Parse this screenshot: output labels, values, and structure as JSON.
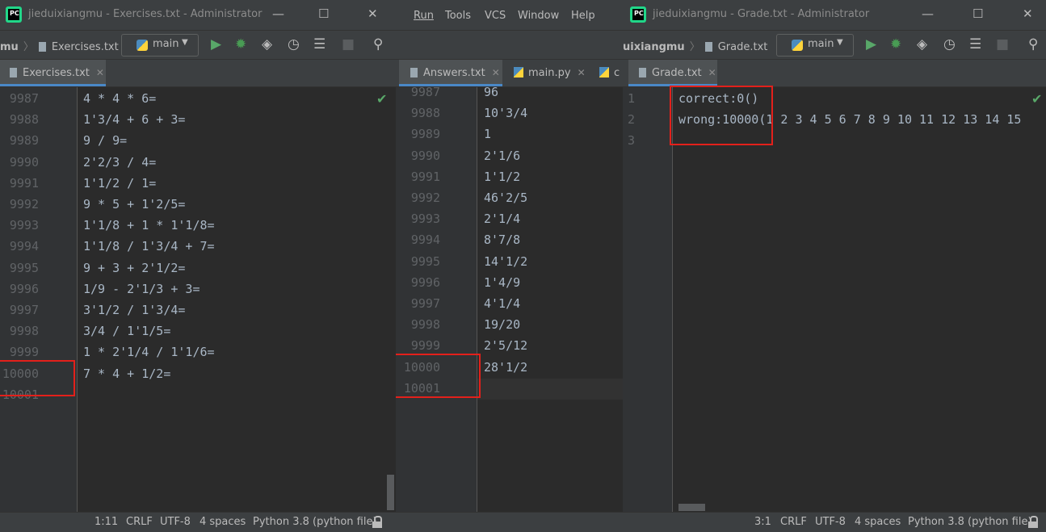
{
  "w1": {
    "title": "jieduixiangmu - Exercises.txt - Administrator",
    "logo": "PC",
    "crumb_project": "mu",
    "crumb_file": "Exercises.txt",
    "run_config": "main",
    "tab": "Exercises.txt",
    "lines": [
      "9987",
      "9988",
      "9989",
      "9990",
      "9991",
      "9992",
      "9993",
      "9994",
      "9995",
      "9996",
      "9997",
      "9998",
      "9999",
      "10000",
      "10001"
    ],
    "code": [
      "4 * 4 * 6=",
      "1'3/4 + 6 + 3=",
      "9 / 9=",
      "2'2/3 / 4=",
      "1'1/2 / 1=",
      "9 * 5 + 1'2/5=",
      "1'1/8 + 1 * 1'1/8=",
      "1'1/8 / 1'3/4 + 7=",
      "9 + 3 + 2'1/2=",
      "1/9 - 2'1/3 + 3=",
      "3'1/2 / 1'3/4=",
      "3/4 / 1'1/5=",
      "1 * 2'1/4 / 1'1/6=",
      "7 * 4 + 1/2=",
      ""
    ],
    "status": {
      "pos": "1:11",
      "eol": "CRLF",
      "enc": "UTF-8",
      "indent": "4 spaces",
      "lang": "Python 3.8 (python file)"
    }
  },
  "w2": {
    "menu": [
      "Run",
      "Tools",
      "VCS",
      "Window",
      "Help"
    ],
    "tabs": [
      "Answers.txt",
      "main.py",
      "c"
    ],
    "lines": [
      "9987",
      "9988",
      "9989",
      "9990",
      "9991",
      "9992",
      "9993",
      "9994",
      "9995",
      "9996",
      "9997",
      "9998",
      "9999",
      "10000",
      "10001"
    ],
    "code": [
      "96",
      "10'3/4",
      "1",
      "2'1/6",
      "1'1/2",
      "46'2/5",
      "2'1/4",
      "8'7/8",
      "14'1/2",
      "1'4/9",
      "4'1/4",
      "19/20",
      "2'5/12",
      "28'1/2",
      ""
    ]
  },
  "w3": {
    "title": "jieduixiangmu - Grade.txt - Administrator",
    "logo": "PC",
    "crumb_project": "uixiangmu",
    "crumb_file": "Grade.txt",
    "run_config": "main",
    "tab": "Grade.txt",
    "lines": [
      "1",
      "2",
      "3"
    ],
    "code": [
      "correct:0()",
      "wrong:10000(1 2 3 4 5 6 7 8 9 10 11 12 13 14 15",
      ""
    ],
    "status": {
      "pos": "3:1",
      "eol": "CRLF",
      "enc": "UTF-8",
      "indent": "4 spaces",
      "lang": "Python 3.8 (python file)"
    }
  },
  "colors": {
    "highlight": "#e3201b",
    "run": "#59a869",
    "debug": "#499c54"
  }
}
